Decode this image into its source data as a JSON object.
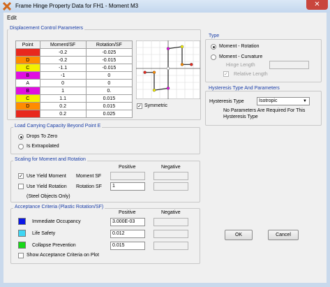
{
  "window": {
    "title": "Frame Hinge Property Data for FH1 - Moment M3",
    "close": "✕"
  },
  "menu": {
    "edit": "Edit"
  },
  "displacement": {
    "group_label": "Displacement Control Parameters",
    "headers": [
      "Point",
      "Moment/SF",
      "Rotation/SF"
    ],
    "rows": [
      {
        "point": "E",
        "moment": "-0.2",
        "rotation": "-0.025",
        "color": "#e8281e"
      },
      {
        "point": "D",
        "moment": "-0.2",
        "rotation": "-0.015",
        "color": "#ff8c00"
      },
      {
        "point": "C",
        "moment": "-1.1",
        "rotation": "-0.015",
        "color": "#f5f000"
      },
      {
        "point": "B",
        "moment": "-1",
        "rotation": "0",
        "color": "#e010e0"
      },
      {
        "point": "A",
        "moment": "0",
        "rotation": "0",
        "color": "#ffffff"
      },
      {
        "point": "B",
        "moment": "1",
        "rotation": "0.",
        "color": "#e010e0"
      },
      {
        "point": "C",
        "moment": "1.1",
        "rotation": "0.015",
        "color": "#f5f000"
      },
      {
        "point": "D",
        "moment": "0.2",
        "rotation": "0.015",
        "color": "#ff8c00"
      },
      {
        "point": "E",
        "moment": "0.2",
        "rotation": "0.025",
        "color": "#e8281e"
      }
    ],
    "symmetric_label": "Symmetric",
    "symmetric_checked": true
  },
  "load_capacity": {
    "group_label": "Load Carrying Capacity Beyond Point E",
    "options": [
      "Drops To Zero",
      "Is Extrapolated"
    ],
    "selected": 0
  },
  "scaling": {
    "group_label": "Scaling for Moment and Rotation",
    "positive_header": "Positive",
    "negative_header": "Negative",
    "use_yield_moment": {
      "label": "Use Yield Moment",
      "checked": true
    },
    "moment_sf_label": "Moment SF",
    "use_yield_rotation": {
      "label": "Use Yield Rotation",
      "checked": false
    },
    "rotation_sf_label": "Rotation SF",
    "rotation_sf_value": "1",
    "steel_note": "(Steel Objects Only)"
  },
  "acceptance": {
    "group_label": "Acceptance Criteria (Plastic Rotation/SF)",
    "positive_header": "Positive",
    "negative_header": "Negative",
    "rows": [
      {
        "label": "Immediate Occupancy",
        "value": "3.000E-03",
        "color": "#0b18e6"
      },
      {
        "label": "Life Safety",
        "value": "0.012",
        "color": "#3fd6f4"
      },
      {
        "label": "Collapse Prevention",
        "value": "0.015",
        "color": "#18d818"
      }
    ],
    "show_on_plot": {
      "label": "Show Acceptance Criteria on Plot",
      "checked": false
    }
  },
  "type": {
    "group_label": "Type",
    "options": [
      "Moment - Rotation",
      "Moment - Curvature"
    ],
    "selected": 0,
    "hinge_length_label": "Hinge Length",
    "relative_length_label": "Relative Length",
    "relative_length_checked": true
  },
  "hysteresis": {
    "group_label": "Hysteresis Type And Parameters",
    "type_label": "Hysteresis Type",
    "selected": "Isotropic",
    "note_line1": "No Parameters Are Required For This",
    "note_line2": "Hysteresis Type"
  },
  "buttons": {
    "ok": "OK",
    "cancel": "Cancel"
  }
}
